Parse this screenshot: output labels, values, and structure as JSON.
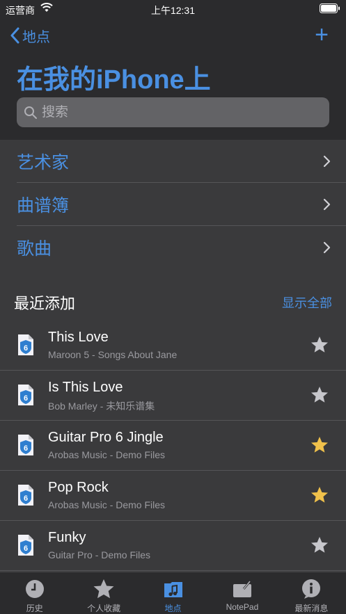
{
  "status_bar": {
    "carrier": "运营商",
    "time": "上午12:31"
  },
  "nav": {
    "back_label": "地点",
    "add_label": "+"
  },
  "title": "在我的iPhone上",
  "search": {
    "placeholder": "搜索"
  },
  "categories": [
    {
      "label": "艺术家"
    },
    {
      "label": "曲谱簿"
    },
    {
      "label": "歌曲"
    }
  ],
  "recent": {
    "title": "最近添加",
    "show_all": "显示全部",
    "songs": [
      {
        "title": "This Love",
        "subtitle": "Maroon 5 - Songs About Jane",
        "favorite": false
      },
      {
        "title": "Is This Love",
        "subtitle": "Bob Marley - 未知乐谱集",
        "favorite": false
      },
      {
        "title": "Guitar Pro 6 Jingle",
        "subtitle": "Arobas Music - Demo Files",
        "favorite": true
      },
      {
        "title": "Pop Rock",
        "subtitle": "Arobas Music - Demo Files",
        "favorite": true
      },
      {
        "title": "Funky",
        "subtitle": "Guitar Pro - Demo Files",
        "favorite": false
      }
    ]
  },
  "tabs": [
    {
      "label": "历史",
      "icon": "clock-icon",
      "active": false
    },
    {
      "label": "个人收藏",
      "icon": "star-icon",
      "active": false
    },
    {
      "label": "地点",
      "icon": "music-folder-icon",
      "active": true
    },
    {
      "label": "NotePad",
      "icon": "notepad-icon",
      "active": false
    },
    {
      "label": "最新消息",
      "icon": "info-icon",
      "active": false
    }
  ],
  "colors": {
    "accent": "#4a90e2",
    "star_on": "#f0c14b",
    "star_off": "#c7c7cc",
    "background": "#3a3a3c",
    "header_bg": "#2b2b2d"
  }
}
